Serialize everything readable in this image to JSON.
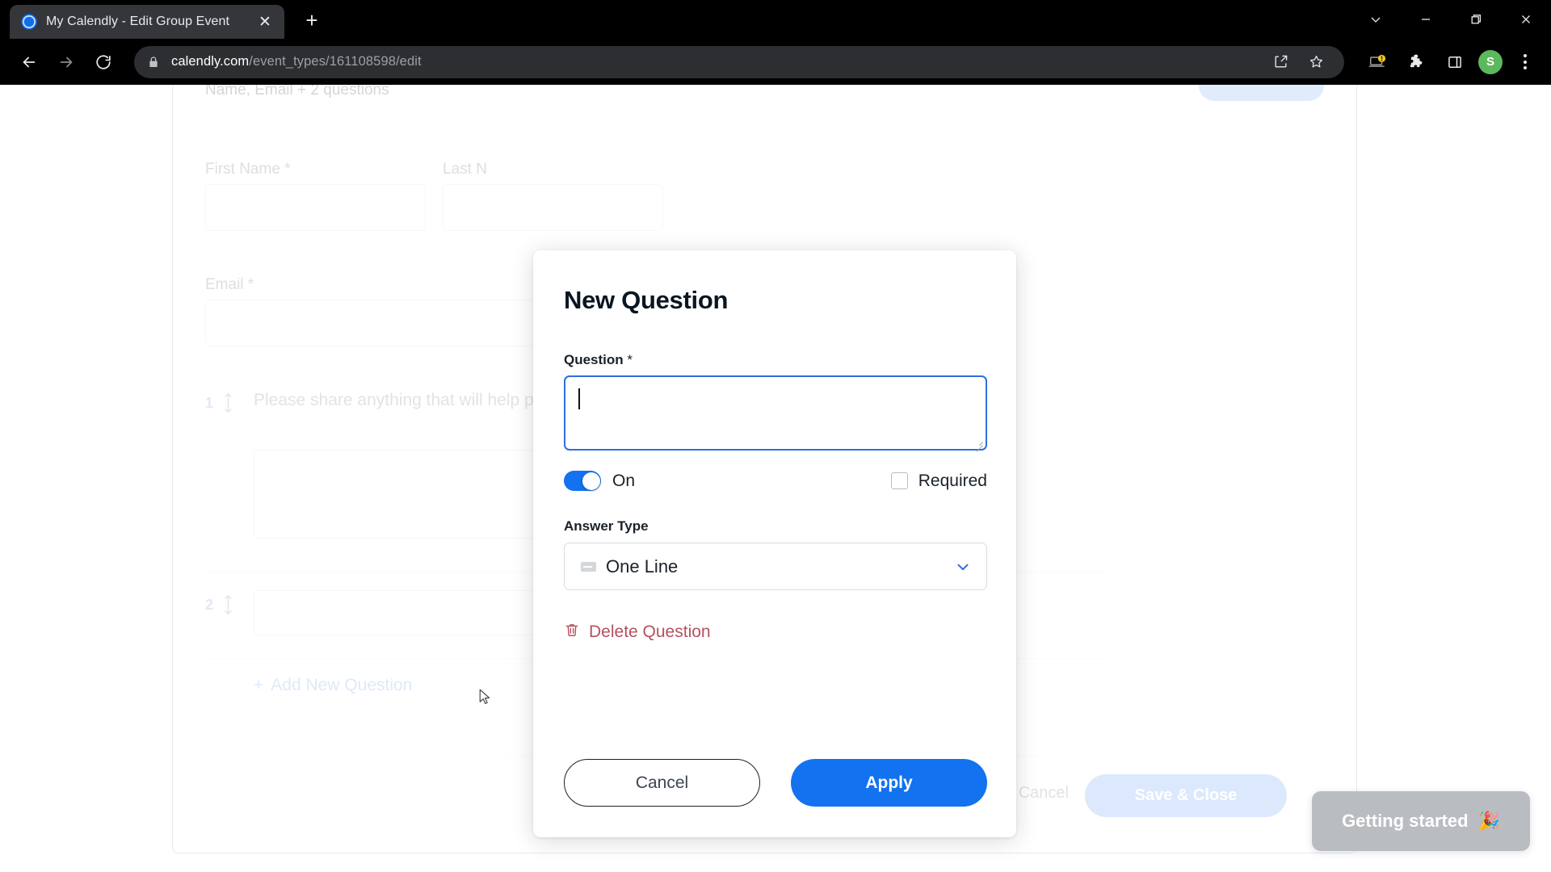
{
  "browser": {
    "tab": {
      "title": "My Calendly - Edit Group Event",
      "close_label": "✕",
      "favicon_name": "calendly-favicon"
    },
    "new_tab_label": "+",
    "window_controls": {
      "tab_search": "tab-search",
      "minimize": "minimize",
      "maximize": "maximize",
      "close": "close"
    },
    "nav": {
      "back": "back",
      "forward": "forward",
      "reload": "reload"
    },
    "address": {
      "host": "calendly.com",
      "path": "/event_types/161108598/edit",
      "full": "calendly.com/event_types/161108598/edit",
      "lock": "secure-lock"
    },
    "toolbar_icons": [
      "share-icon",
      "bookmark-star-icon",
      "device-notification-icon",
      "extensions-puzzle-icon",
      "side-panel-icon"
    ],
    "profile_initial": "S",
    "menu": "chrome-menu"
  },
  "page": {
    "subtitle": "Name, Email + 2 questions",
    "fields": {
      "first_name": "First Name *",
      "last_name": "Last N",
      "email": "Email *"
    },
    "questions": [
      {
        "number": "1",
        "text": "Please share anything that will help prepare for our meeting."
      },
      {
        "number": "2",
        "text": ""
      }
    ],
    "add_new_question": "Add New Question",
    "add_new_question_plus": "+",
    "footer": {
      "cancel": "Cancel",
      "save": "Save & Close"
    }
  },
  "modal": {
    "title": "New Question",
    "question_label": "Question",
    "question_required_mark": "*",
    "question_value": "",
    "toggle": {
      "state_label": "On",
      "on": true
    },
    "required_checkbox": {
      "label": "Required",
      "checked": false
    },
    "answer_type_label": "Answer Type",
    "answer_type_value": "One Line",
    "answer_type_icon": "one-line-icon",
    "delete_link": "Delete Question",
    "delete_icon": "trash-icon",
    "buttons": {
      "cancel": "Cancel",
      "apply": "Apply"
    }
  },
  "widget": {
    "getting_started": "Getting started",
    "emoji": "🎉"
  },
  "colors": {
    "accent_blue": "#1272f0",
    "toggle_blue": "#1272f0",
    "focus_border": "#2f6fdc",
    "delete_red": "#b4515f",
    "avatar_green": "#5cb85c",
    "chrome_dark": "#000000",
    "tab_bg": "#35363a",
    "omnibox_bg": "#2d2e31",
    "muted_text": "#9aa1aa",
    "widget_grey": "#b9bcc0"
  }
}
